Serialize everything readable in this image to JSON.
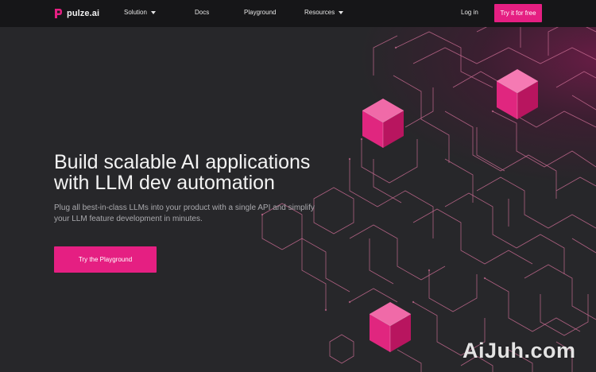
{
  "header": {
    "logo_text": "pulze.ai",
    "nav": [
      {
        "label": "Solution",
        "has_dropdown": true
      },
      {
        "label": "Docs",
        "has_dropdown": false
      },
      {
        "label": "Playground",
        "has_dropdown": false
      },
      {
        "label": "Resources",
        "has_dropdown": true
      }
    ],
    "login_label": "Log in",
    "try_label": "Try it for free"
  },
  "hero": {
    "title_line1": "Build scalable AI applications",
    "title_line2": "with LLM dev automation",
    "subtitle_line1": "Plug all best-in-class LLMs into your product with a single API and simplify",
    "subtitle_line2": "your LLM feature development in minutes.",
    "cta_label": "Try the Playground"
  },
  "watermark": "AiJuh.com",
  "colors": {
    "accent": "#e51f82",
    "background": "#27272a",
    "header": "#161618",
    "circuit_line": "#c06a8c"
  }
}
